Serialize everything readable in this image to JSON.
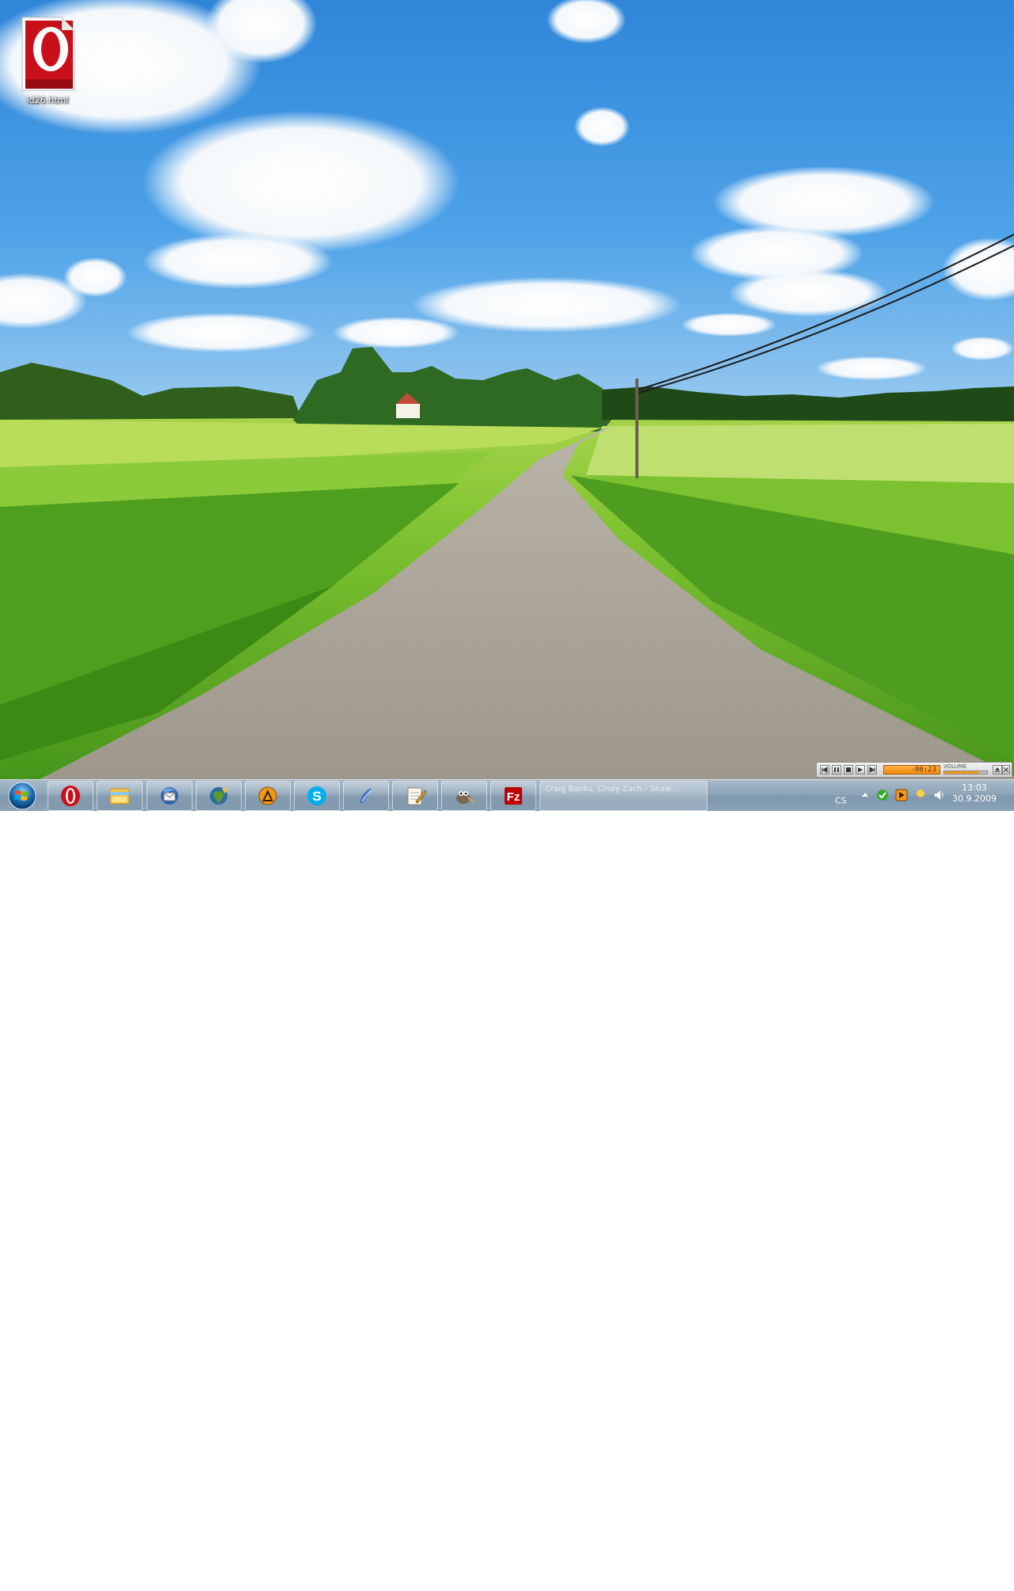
{
  "desktop": {
    "icons": [
      {
        "label": "id26.html",
        "icon": "opera-html-file-icon"
      }
    ]
  },
  "taskbar": {
    "start_icon": "windows-start-orb",
    "pinned": [
      {
        "name": "opera",
        "icon": "opera-icon",
        "color": "#cc0f16"
      },
      {
        "name": "windows-explorer",
        "icon": "folder-icon",
        "color": "#f2c74a"
      },
      {
        "name": "thunderbird",
        "icon": "thunderbird-icon",
        "color": "#2f63b5"
      },
      {
        "name": "jdownloader",
        "icon": "jdownloader-icon",
        "color": "#5a9a2e"
      },
      {
        "name": "aimp",
        "icon": "aimp-icon",
        "color": "#f09a1a"
      },
      {
        "name": "skype",
        "icon": "skype-icon",
        "color": "#00aff0"
      },
      {
        "name": "winamp-like",
        "icon": "pen-tool-icon",
        "color": "#3d6fb8"
      },
      {
        "name": "notepad",
        "icon": "notepad-icon",
        "color": "#e8e2c6"
      },
      {
        "name": "gimp",
        "icon": "gimp-icon",
        "color": "#7a6a53"
      },
      {
        "name": "filezilla",
        "icon": "filezilla-icon",
        "color": "#bf0000"
      }
    ],
    "active_thumbnail": {
      "line1": "Craig Banks, Cindy Zach - Shaw...",
      "line2": ""
    }
  },
  "tray": {
    "language": "CS",
    "icons": [
      "show-hidden-icons-arrow",
      "green-check-icon",
      "aimp-tray-icon",
      "lightbulb-icon",
      "volume-icon"
    ],
    "time": "13:03",
    "date": "30.9.2009"
  },
  "mini_player": {
    "time": "-00:23",
    "volume_label": "VOLUME",
    "volume_fraction": 0.82,
    "buttons": [
      "prev",
      "pause",
      "stop",
      "play",
      "next"
    ]
  }
}
